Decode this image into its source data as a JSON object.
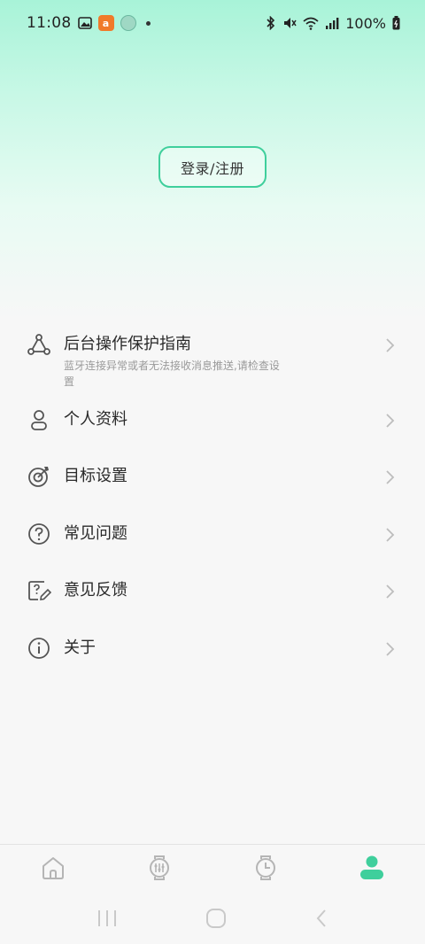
{
  "status_bar": {
    "time": "11:08",
    "battery": "100%",
    "icons": [
      "gallery-icon",
      "app-icon",
      "app-icon-2",
      "bluetooth-icon",
      "mute-icon",
      "wifi-icon",
      "signal-icon",
      "battery-icon"
    ]
  },
  "login": {
    "label": "登录/注册"
  },
  "menu": {
    "items": [
      {
        "label": "后台操作保护指南",
        "sub": "蓝牙连接异常或者无法接收消息推送,请检查设置",
        "icon": "share-network-icon"
      },
      {
        "label": "个人资料",
        "icon": "person-icon"
      },
      {
        "label": "目标设置",
        "icon": "target-icon"
      },
      {
        "label": "常见问题",
        "icon": "question-icon"
      },
      {
        "label": "意见反馈",
        "icon": "feedback-icon"
      },
      {
        "label": "关于",
        "icon": "info-icon"
      }
    ]
  },
  "bottom_nav": {
    "tabs": [
      {
        "name": "home",
        "icon": "home-icon",
        "active": false
      },
      {
        "name": "device",
        "icon": "watch-icon",
        "active": false
      },
      {
        "name": "activity",
        "icon": "clock-watch-icon",
        "active": false
      },
      {
        "name": "profile",
        "icon": "person-filled-icon",
        "active": true
      }
    ]
  },
  "colors": {
    "accent": "#3fcf9c",
    "icon": "#555555",
    "chevron": "#bdbdbd",
    "nav_inactive": "#b5b5b5"
  }
}
